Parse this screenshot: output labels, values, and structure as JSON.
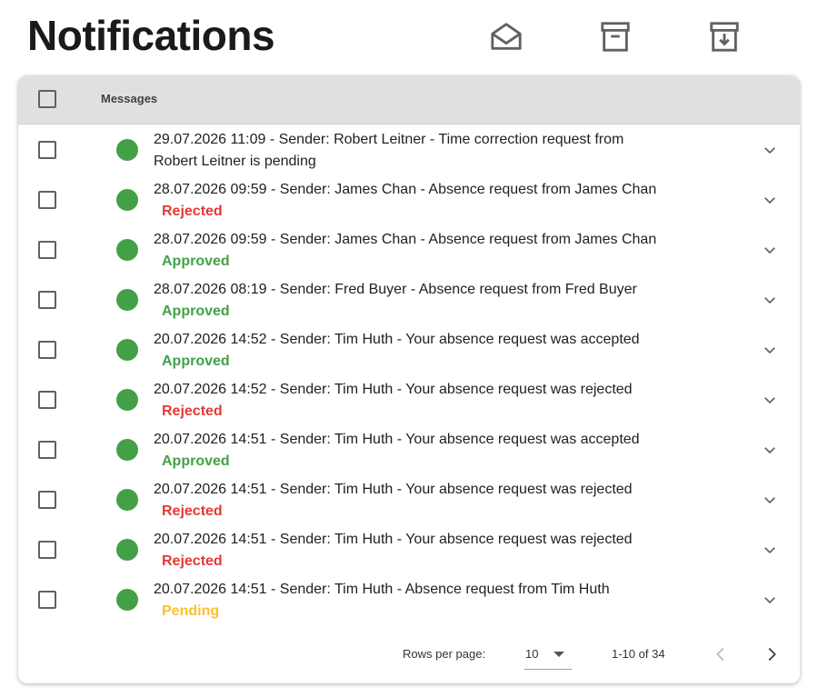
{
  "page": {
    "title": "Notifications"
  },
  "toolbar": {
    "icons": [
      "mark-read-icon",
      "archive-icon",
      "unarchive-icon"
    ]
  },
  "table": {
    "header": {
      "messages_label": "Messages"
    },
    "rows": [
      {
        "text": "29.07.2026 11:09 - Sender: Robert Leitner - Time correction request from Robert Leitner is pending",
        "status": ""
      },
      {
        "text": "28.07.2026 09:59 - Sender: James Chan - Absence request from James Chan",
        "status": "Rejected"
      },
      {
        "text": "28.07.2026 09:59 - Sender: James Chan - Absence request from James Chan",
        "status": "Approved"
      },
      {
        "text": "28.07.2026 08:19 - Sender: Fred Buyer - Absence request from Fred Buyer",
        "status": "Approved"
      },
      {
        "text": "20.07.2026 14:52 - Sender: Tim Huth - Your absence request was accepted",
        "status": "Approved"
      },
      {
        "text": "20.07.2026 14:52 - Sender: Tim Huth - Your absence request was rejected",
        "status": "Rejected"
      },
      {
        "text": "20.07.2026 14:51 - Sender: Tim Huth - Your absence request was accepted",
        "status": "Approved"
      },
      {
        "text": "20.07.2026 14:51 - Sender: Tim Huth - Your absence request was rejected",
        "status": "Rejected"
      },
      {
        "text": "20.07.2026 14:51 - Sender: Tim Huth - Your absence request was rejected",
        "status": "Rejected"
      },
      {
        "text": "20.07.2026 14:51 - Sender: Tim Huth - Absence request from Tim Huth",
        "status": "Pending"
      }
    ]
  },
  "status_colors": {
    "Rejected": "#e53935",
    "Approved": "#43a047",
    "Pending": "#fbc02d"
  },
  "unread_dot_color": "#43a047",
  "pagination": {
    "rows_per_page_label": "Rows per page:",
    "rows_per_page_value": "10",
    "range_text": "1-10 of 34"
  }
}
